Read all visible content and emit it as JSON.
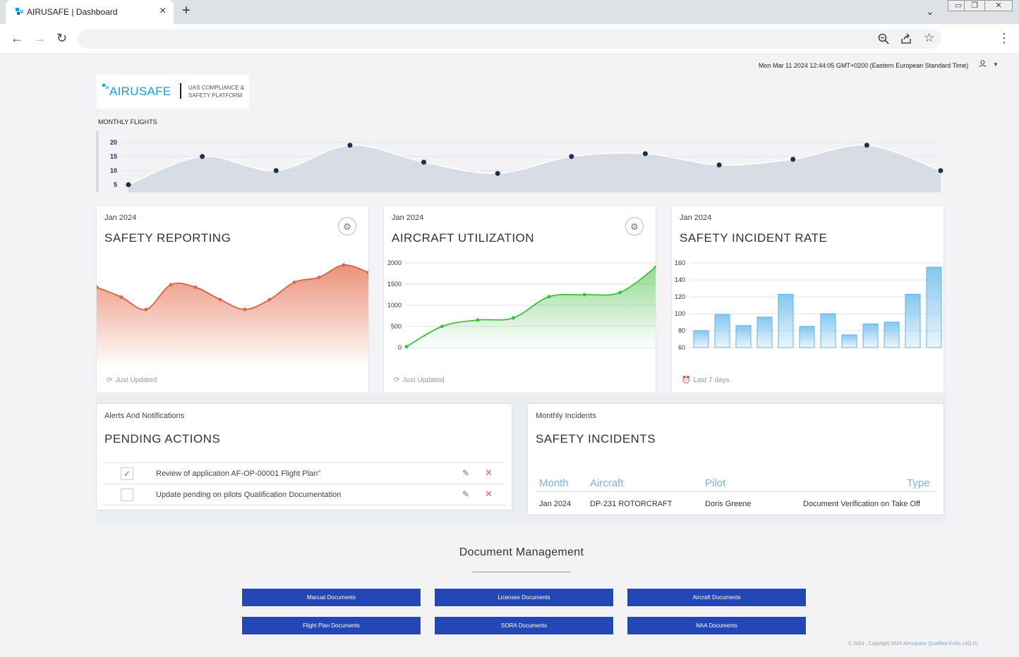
{
  "browser": {
    "tab_title": "AIRUSAFE |  Dashboard",
    "tab_close": "×",
    "new_tab": "+"
  },
  "header": {
    "datetime": "Mon Mar 11 2024 12:44:05 GMT+0200 (Eastern European Standard Time)"
  },
  "logo": {
    "word": "AIRUSAFE",
    "tagline": "UAS COMPLIANCE & SAFETY PLATFORM"
  },
  "monthly_flights": {
    "label": "MONTHLY FLIGHTS"
  },
  "cards": {
    "safety_reporting": {
      "subtitle": "Jan 2024",
      "title": "SAFETY REPORTING",
      "footer": "Just Updated"
    },
    "aircraft_utilization": {
      "subtitle": "Jan 2024",
      "title": "AIRCRAFT UTILIZATION",
      "footer": "Just Updated"
    },
    "incident_rate": {
      "subtitle": "Jan 2024",
      "title": "SAFETY INCIDENT RATE",
      "footer": "Last 7 days"
    }
  },
  "pending": {
    "subtitle": "Alerts And Notifications",
    "title": "PENDING ACTIONS",
    "rows": [
      {
        "text": "Review of application AF-OP-00001 Flight Plan\"",
        "checked": true
      },
      {
        "text": "Update pending on pilots Qualification Documentation",
        "checked": false
      }
    ]
  },
  "incidents": {
    "subtitle": "Monthly Incidents",
    "title": "SAFETY INCIDENTS",
    "headers": [
      "Month",
      "Aircraft",
      "Pilot",
      "Type"
    ],
    "rows": [
      {
        "month": "Jan 2024",
        "aircraft": "DP-231 ROTORCRAFT",
        "pilot": "Doris Greene",
        "type": "Document Verification on Take Off"
      }
    ]
  },
  "documents": {
    "title": "Document Management",
    "buttons": [
      "Manual Documents",
      "Licenses Documents",
      "Aircraft Documents",
      "Flight Plan Documents",
      "SORA Documents",
      "NAA Documents"
    ]
  },
  "footer": {
    "text": "© 2024 , Copyright 2024",
    "link": "Aerospace Qualified Entity (AQ-E)"
  },
  "colors": {
    "primary_button": "#2347b7",
    "safety_reporting": "#e8866a",
    "aircraft_utilization": "#4cc04c",
    "incident_rate": "#7ec3ee",
    "monthly_flights_dot": "#1c2f4f"
  },
  "chart_data": [
    {
      "id": "monthly_flights",
      "type": "area",
      "title": "MONTHLY FLIGHTS",
      "x": [
        1,
        2,
        3,
        4,
        5,
        6,
        7,
        8,
        9,
        10,
        11,
        12
      ],
      "values": [
        5,
        15,
        10,
        19,
        13,
        9,
        15,
        16,
        12,
        14,
        19,
        10
      ],
      "yticks": [
        5,
        10,
        15,
        20
      ],
      "ylim": [
        5,
        20
      ],
      "grid": true
    },
    {
      "id": "safety_reporting",
      "type": "area",
      "title": "SAFETY REPORTING",
      "x": [
        0,
        1,
        2,
        3,
        4,
        5,
        6,
        7,
        8,
        9,
        10,
        11
      ],
      "values": [
        27,
        23,
        18,
        28,
        27,
        22,
        18,
        22,
        29,
        31,
        36,
        33
      ],
      "ylim": [
        0,
        40
      ],
      "grid": false
    },
    {
      "id": "aircraft_utilization",
      "type": "area",
      "title": "AIRCRAFT UTILIZATION",
      "x": [
        0,
        1,
        2,
        3,
        4,
        5,
        6,
        7
      ],
      "values": [
        20,
        500,
        650,
        700,
        1200,
        1250,
        1300,
        1900
      ],
      "yticks": [
        0,
        500,
        1000,
        1500,
        2000
      ],
      "ylim": [
        0,
        2000
      ],
      "grid": true
    },
    {
      "id": "incident_rate",
      "type": "bar",
      "title": "SAFETY INCIDENT RATE",
      "categories": [
        "1",
        "2",
        "3",
        "4",
        "5",
        "6",
        "7",
        "8",
        "9",
        "10",
        "11",
        "12"
      ],
      "values": [
        80,
        99,
        86,
        96,
        123,
        85,
        100,
        75,
        88,
        90,
        123,
        155
      ],
      "yticks": [
        60,
        80,
        100,
        120,
        140,
        160
      ],
      "ylim": [
        60,
        160
      ],
      "grid": true
    }
  ]
}
